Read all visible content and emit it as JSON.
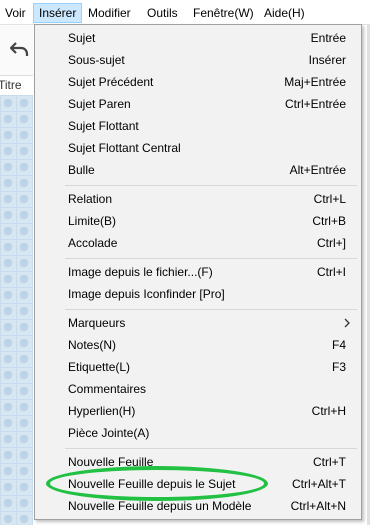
{
  "menubar": {
    "items": [
      {
        "label": "Voir"
      },
      {
        "label": "Insérer"
      },
      {
        "label": "Modifier"
      },
      {
        "label": "Outils"
      },
      {
        "label": "Fenêtre(W)"
      },
      {
        "label": "Aide(H)"
      }
    ]
  },
  "tabs": {
    "partial_label": "Titre"
  },
  "insert_menu": {
    "items": [
      {
        "label": "Sujet",
        "shortcut": "Entrée"
      },
      {
        "label": "Sous-sujet",
        "shortcut": "Insérer"
      },
      {
        "label": "Sujet Précédent",
        "shortcut": "Maj+Entrée"
      },
      {
        "label": "Sujet Paren",
        "shortcut": "Ctrl+Entrée"
      },
      {
        "label": "Sujet Flottant",
        "shortcut": ""
      },
      {
        "label": "Sujet Flottant Central",
        "shortcut": ""
      },
      {
        "label": "Bulle",
        "shortcut": "Alt+Entrée"
      },
      {
        "label": "Relation",
        "shortcut": "Ctrl+L"
      },
      {
        "label": "Limite(B)",
        "shortcut": "Ctrl+B"
      },
      {
        "label": "Accolade",
        "shortcut": "Ctrl+]"
      },
      {
        "label": "Image depuis le fichier...(F)",
        "shortcut": "Ctrl+I"
      },
      {
        "label": "Image depuis Iconfinder [Pro]",
        "shortcut": ""
      },
      {
        "label": "Marqueurs",
        "shortcut": ""
      },
      {
        "label": "Notes(N)",
        "shortcut": "F4"
      },
      {
        "label": "Etiquette(L)",
        "shortcut": "F3"
      },
      {
        "label": "Commentaires",
        "shortcut": ""
      },
      {
        "label": "Hyperlien(H)",
        "shortcut": "Ctrl+H"
      },
      {
        "label": "Pièce Jointe(A)",
        "shortcut": ""
      },
      {
        "label": "Nouvelle Feuille",
        "shortcut": "Ctrl+T"
      },
      {
        "label": "Nouvelle Feuille depuis le Sujet",
        "shortcut": "Ctrl+Alt+T"
      },
      {
        "label": "Nouvelle Feuille depuis un Modèle",
        "shortcut": "Ctrl+Alt+N"
      }
    ]
  },
  "colors": {
    "menu_bg": "#f2f2f2",
    "active_menu_bg": "#cce8ff",
    "highlight_ring": "#22c043"
  },
  "icons": [
    "undo-icon",
    "chevron-right-icon"
  ]
}
